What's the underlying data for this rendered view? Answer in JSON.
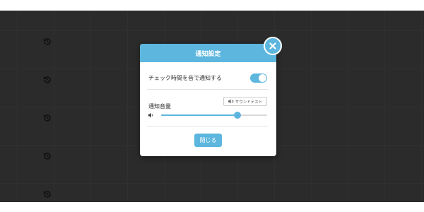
{
  "modal": {
    "title": "通知設定",
    "notify_label": "チェック時間を音で通知する",
    "notify_enabled": true,
    "volume_label": "通知音量",
    "sound_test_label": "サウンドテスト",
    "volume_level": 0.72,
    "close_label": "閉じる"
  },
  "icons": {
    "close": "close-x-icon",
    "sound_test": "speaker-icon",
    "volume": "speaker-low-icon",
    "background": "history-icon"
  },
  "colors": {
    "accent": "#5cb6de",
    "backdrop": "#2b2b2b"
  }
}
